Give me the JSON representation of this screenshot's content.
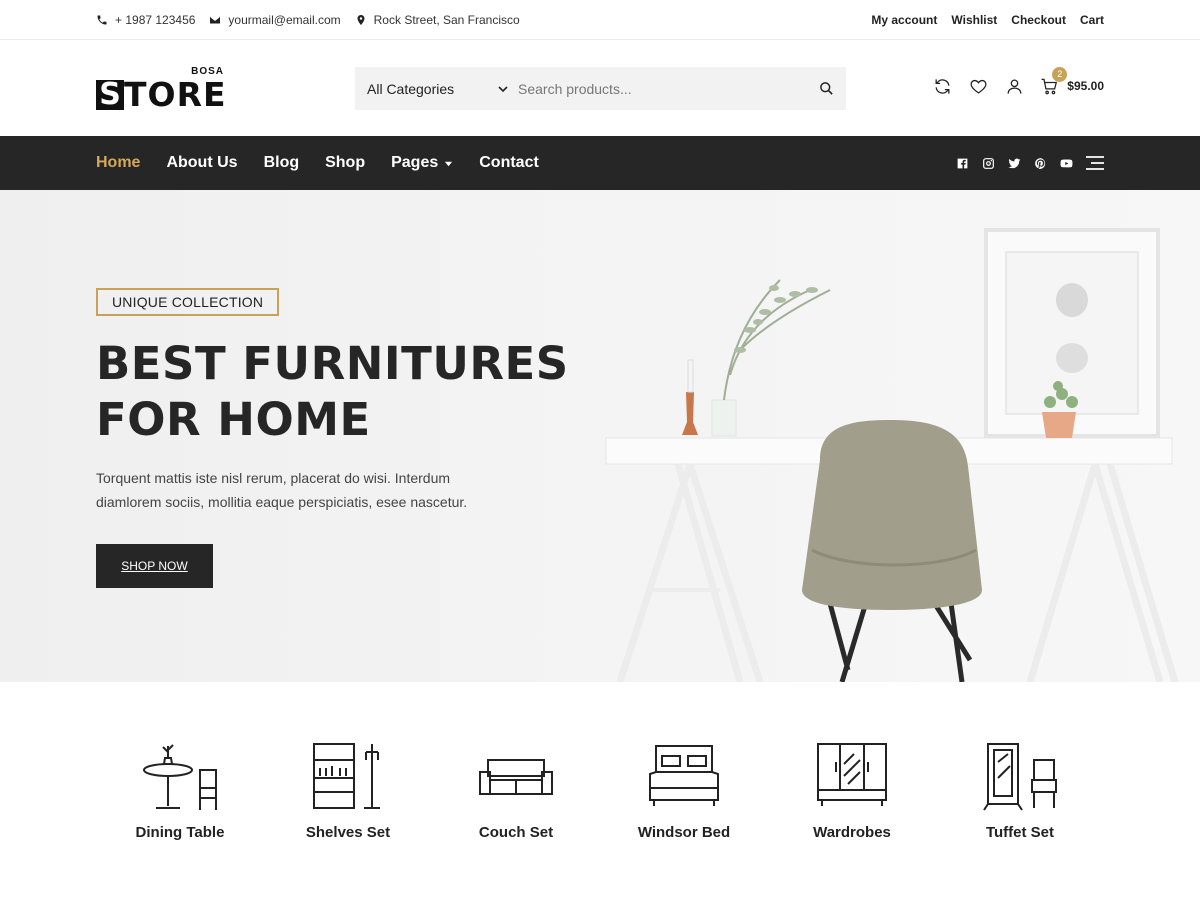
{
  "topbar": {
    "phone": "+ 1987 123456",
    "email": "yourmail@email.com",
    "address": "Rock Street, San Francisco",
    "links": [
      "My account",
      "Wishlist",
      "Checkout",
      "Cart"
    ]
  },
  "logo": {
    "brand_top": "BOSA",
    "brand_s": "S",
    "brand_rest": "TORE"
  },
  "search": {
    "category": "All Categories",
    "placeholder": "Search products..."
  },
  "cart": {
    "count": "2",
    "total": "$95.00"
  },
  "nav": {
    "items": [
      "Home",
      "About Us",
      "Blog",
      "Shop",
      "Pages",
      "Contact"
    ],
    "active": "Home",
    "social_icons": [
      "facebook-icon",
      "instagram-icon",
      "twitter-icon",
      "pinterest-icon",
      "youtube-icon"
    ]
  },
  "hero": {
    "tag": "UNIQUE COLLECTION",
    "title_line1": "BEST FURNITURES",
    "title_line2": "FOR HOME",
    "description": "Torquent mattis iste nisl rerum, placerat do wisi. Interdum diamlorem sociis, mollitia eaque perspiciatis, esee nascetur.",
    "button": "SHOP NOW"
  },
  "categories": [
    {
      "label": "Dining Table",
      "icon": "dining-table-icon"
    },
    {
      "label": "Shelves Set",
      "icon": "shelves-icon"
    },
    {
      "label": "Couch Set",
      "icon": "couch-icon"
    },
    {
      "label": "Windsor Bed",
      "icon": "bed-icon"
    },
    {
      "label": "Wardrobes",
      "icon": "wardrobe-icon"
    },
    {
      "label": "Tuffet Set",
      "icon": "tuffet-icon"
    }
  ],
  "colors": {
    "accent": "#c8a257",
    "nav_bg": "#262626",
    "active_nav": "#d3a85b"
  }
}
